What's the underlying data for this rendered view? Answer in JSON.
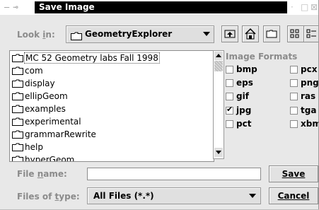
{
  "window": {
    "title_controls_left": "— ⊸",
    "title": "Save Image",
    "title_controls_right_min": "·",
    "title_controls_right_max": "□",
    "title_controls_right_close": "⊠"
  },
  "look_in": {
    "label": "Look in:",
    "label_prefix": "Look ",
    "label_mnemonic": "i",
    "label_suffix": "n:",
    "value": "GeometryExplorer"
  },
  "toolbar": {
    "up_icon": "up-folder-icon",
    "home_icon": "home-icon",
    "new_folder_icon": "new-folder-icon",
    "list_view_icon": "list-view-icon",
    "details_view_icon": "details-view-icon"
  },
  "files": [
    {
      "name": "MC 52 Geometry labs Fall 1998",
      "icon": "folder-icon",
      "selected": true
    },
    {
      "name": "com",
      "icon": "folder-icon"
    },
    {
      "name": "display",
      "icon": "folder-icon"
    },
    {
      "name": "ellipGeom",
      "icon": "folder-icon"
    },
    {
      "name": "examples",
      "icon": "folder-icon"
    },
    {
      "name": "experimental",
      "icon": "folder-icon"
    },
    {
      "name": "grammarRewrite",
      "icon": "folder-icon"
    },
    {
      "name": "help",
      "icon": "folder-icon"
    },
    {
      "name": "hyperGeom",
      "icon": "folder-icon"
    }
  ],
  "image_formats": {
    "title": "Image Formats",
    "left": [
      {
        "label": "bmp",
        "checked": false
      },
      {
        "label": "eps",
        "checked": false
      },
      {
        "label": "gif",
        "checked": false
      },
      {
        "label": "jpg",
        "checked": true
      },
      {
        "label": "pct",
        "checked": false
      }
    ],
    "right": [
      {
        "label": "pcx",
        "checked": false
      },
      {
        "label": "png",
        "checked": false
      },
      {
        "label": "ras",
        "checked": false
      },
      {
        "label": "tga",
        "checked": false
      },
      {
        "label": "xbm",
        "checked": false
      }
    ]
  },
  "file_name": {
    "label_prefix": "File ",
    "label_mnemonic": "n",
    "label_suffix": "ame:",
    "value": ""
  },
  "files_of_type": {
    "label_prefix": "Files of ",
    "label_mnemonic": "t",
    "label_suffix": "ype:",
    "value": "All Files (*.*)"
  },
  "buttons": {
    "save": "Save",
    "cancel": "Cancel"
  }
}
